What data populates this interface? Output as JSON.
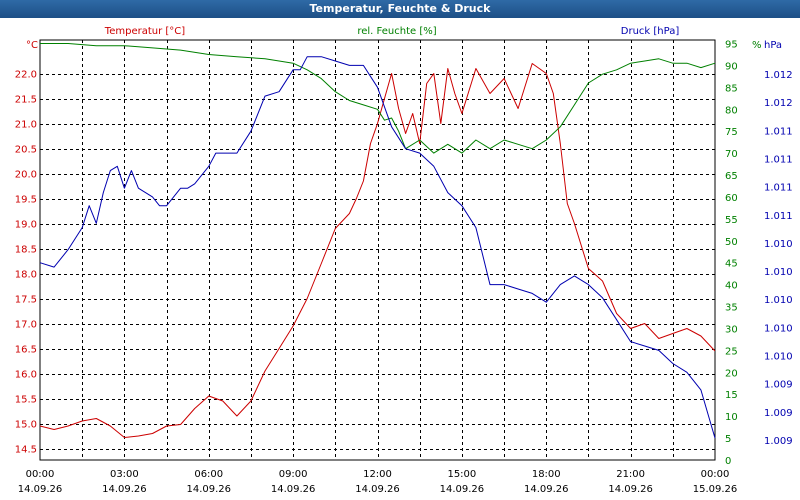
{
  "title": "Temperatur, Feuchte & Druck",
  "chart_data": {
    "type": "line",
    "title": "Temperatur, Feuchte & Druck",
    "x_ticks": [
      {
        "time": "00:00",
        "date": "14.09.26"
      },
      {
        "time": "03:00",
        "date": "14.09.26"
      },
      {
        "time": "06:00",
        "date": "14.09.26"
      },
      {
        "time": "09:00",
        "date": "14.09.26"
      },
      {
        "time": "12:00",
        "date": "14.09.26"
      },
      {
        "time": "15:00",
        "date": "14.09.26"
      },
      {
        "time": "18:00",
        "date": "14.09.26"
      },
      {
        "time": "21:00",
        "date": "14.09.26"
      },
      {
        "time": "00:00",
        "date": "15.09.26"
      }
    ],
    "grid": true,
    "axes": {
      "left": {
        "unit": "°C",
        "min": 14.5,
        "max": 22.0,
        "ticks": [
          "22.0",
          "21.5",
          "21.0",
          "20.5",
          "20.0",
          "19.5",
          "19.0",
          "18.5",
          "18.0",
          "17.5",
          "17.0",
          "16.5",
          "16.0",
          "15.5",
          "15.0",
          "14.5"
        ],
        "color": "#cc0000"
      },
      "middle": {
        "unit": "%",
        "min": 0,
        "max": 95,
        "ticks": [
          "95",
          "90",
          "85",
          "80",
          "75",
          "70",
          "65",
          "60",
          "55",
          "50",
          "45",
          "40",
          "35",
          "30",
          "25",
          "20",
          "15",
          "10",
          "5",
          "0"
        ],
        "color": "#008000"
      },
      "right": {
        "unit": "hPa",
        "ticks": [
          "1.012",
          "1.012",
          "1.011",
          "1.011",
          "1.011",
          "1.011",
          "1.010",
          "1.010",
          "1.010",
          "1.010",
          "1.010",
          "1.009",
          "1.009",
          "1.009"
        ],
        "color": "#0000b0"
      }
    },
    "series": [
      {
        "name": "Temperatur [°C]",
        "color": "#cc0000",
        "axis": "left",
        "x": [
          0,
          0.5,
          1,
          1.5,
          2,
          2.5,
          3,
          3.5,
          4,
          4.5,
          5,
          5.5,
          6,
          6.5,
          7,
          7.5,
          8,
          8.5,
          9,
          9.5,
          10,
          10.5,
          11,
          11.25,
          11.5,
          11.75,
          12,
          12.25,
          12.5,
          12.75,
          13,
          13.25,
          13.5,
          13.75,
          14,
          14.25,
          14.5,
          14.75,
          15,
          15.5,
          16,
          16.5,
          17,
          17.5,
          18,
          18.25,
          18.5,
          18.75,
          19,
          19.5,
          20,
          20.5,
          21,
          21.5,
          22,
          22.5,
          23,
          23.5,
          24
        ],
        "y": [
          14.95,
          14.88,
          14.95,
          15.05,
          15.1,
          14.95,
          14.72,
          14.75,
          14.8,
          14.95,
          14.98,
          15.3,
          15.55,
          15.45,
          15.15,
          15.45,
          16.05,
          16.5,
          16.95,
          17.5,
          18.2,
          18.9,
          19.2,
          19.5,
          19.85,
          20.6,
          21.0,
          21.5,
          22.0,
          21.3,
          20.8,
          21.2,
          20.6,
          21.8,
          22.0,
          21.0,
          22.1,
          21.6,
          21.2,
          22.1,
          21.6,
          21.9,
          21.3,
          22.2,
          22.0,
          21.6,
          20.6,
          19.4,
          19.0,
          18.1,
          17.85,
          17.2,
          16.9,
          17.0,
          16.7,
          16.8,
          16.9,
          16.75,
          16.45
        ]
      },
      {
        "name": "rel. Feuchte [%]",
        "color": "#008000",
        "axis": "middle",
        "x": [
          0,
          1,
          2,
          3,
          4,
          5,
          6,
          7,
          8,
          8.5,
          9,
          9.5,
          10,
          10.5,
          11,
          11.5,
          12,
          12.25,
          12.5,
          12.75,
          13,
          13.5,
          14,
          14.5,
          15,
          15.5,
          16,
          16.5,
          17,
          17.5,
          18,
          18.5,
          19,
          19.5,
          20,
          20.5,
          21,
          21.5,
          22,
          22.5,
          23,
          23.5,
          24
        ],
        "y": [
          95,
          95,
          94.5,
          94.5,
          94,
          93.5,
          92.5,
          92,
          91.5,
          91,
          90.5,
          89,
          87,
          84,
          82,
          81,
          80,
          77.5,
          78,
          75,
          71,
          73,
          70,
          72,
          70,
          73,
          71,
          73,
          72,
          71,
          73,
          76,
          81,
          86,
          88,
          89,
          90.5,
          91,
          91.5,
          90.5,
          90.5,
          89.5,
          90.5
        ]
      },
      {
        "name": "Druck [hPa]",
        "color": "#0000b0",
        "axis": "middle",
        "x": [
          0,
          0.5,
          1,
          1.5,
          1.75,
          2,
          2.25,
          2.5,
          2.75,
          3,
          3.25,
          3.5,
          4,
          4.25,
          4.5,
          5,
          5.25,
          5.5,
          6,
          6.25,
          6.5,
          7,
          7.5,
          8,
          8.5,
          9,
          9.25,
          9.5,
          10,
          10.5,
          11,
          11.5,
          12,
          12.5,
          13,
          13.5,
          14,
          14.5,
          15,
          15.5,
          16,
          16.5,
          17,
          17.5,
          18,
          18.5,
          19,
          19.5,
          20,
          20.5,
          21,
          21.5,
          22,
          22.5,
          23,
          23.5,
          24
        ],
        "y": [
          45,
          44,
          48,
          53,
          58,
          54,
          61,
          66,
          67,
          62,
          66,
          62,
          60,
          58,
          58,
          62,
          62,
          63,
          67,
          70,
          70,
          70,
          75,
          83,
          84,
          89,
          89,
          92,
          92,
          91,
          90,
          90,
          85,
          76,
          71,
          70,
          67,
          61,
          58,
          53,
          40,
          40,
          39,
          38,
          36,
          40,
          42,
          40,
          37,
          32,
          27,
          26,
          25,
          22,
          20,
          16,
          5
        ]
      }
    ]
  }
}
